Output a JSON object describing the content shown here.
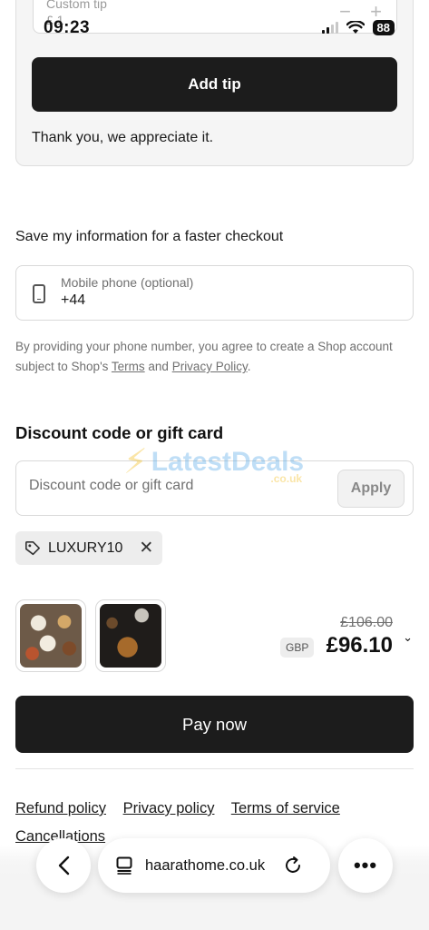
{
  "status_bar": {
    "time": "09:23",
    "battery": "88",
    "wifi_icon": "wifi-icon",
    "signal_icon": "cellular-signal-icon"
  },
  "tip": {
    "custom_tip_label": "Custom tip",
    "custom_tip_value": "£ 1",
    "minus_label": "−",
    "plus_label": "+",
    "add_tip_label": "Add tip",
    "thanks_text": "Thank you, we appreciate it."
  },
  "save_info": {
    "title": "Save my information for a faster checkout",
    "phone_label": "Mobile phone (optional)",
    "phone_value": "+44",
    "legal_prefix": "By providing your phone number, you agree to create a Shop account subject to Shop's ",
    "terms_link": "Terms",
    "legal_and": " and ",
    "privacy_link": "Privacy Policy",
    "legal_suffix": "."
  },
  "discount": {
    "title": "Discount code or gift card",
    "placeholder": "Discount code or gift card",
    "apply_label": "Apply",
    "applied_code": "LUXURY10"
  },
  "watermark": {
    "main": "LatestDeals",
    "sub": ".co.uk"
  },
  "order": {
    "old_price": "£106.00",
    "currency": "GBP",
    "new_price": "£96.10"
  },
  "pay_label": "Pay now",
  "footer": {
    "refund": "Refund policy",
    "privacy": "Privacy policy",
    "terms": "Terms of service",
    "cancellations": "Cancellations"
  },
  "browser": {
    "url": "haarathome.co.uk",
    "more_label": "•••"
  },
  "colors": {
    "button_dark": "#1c1c1c",
    "muted_text": "#707070",
    "border": "#d9d9d9"
  }
}
